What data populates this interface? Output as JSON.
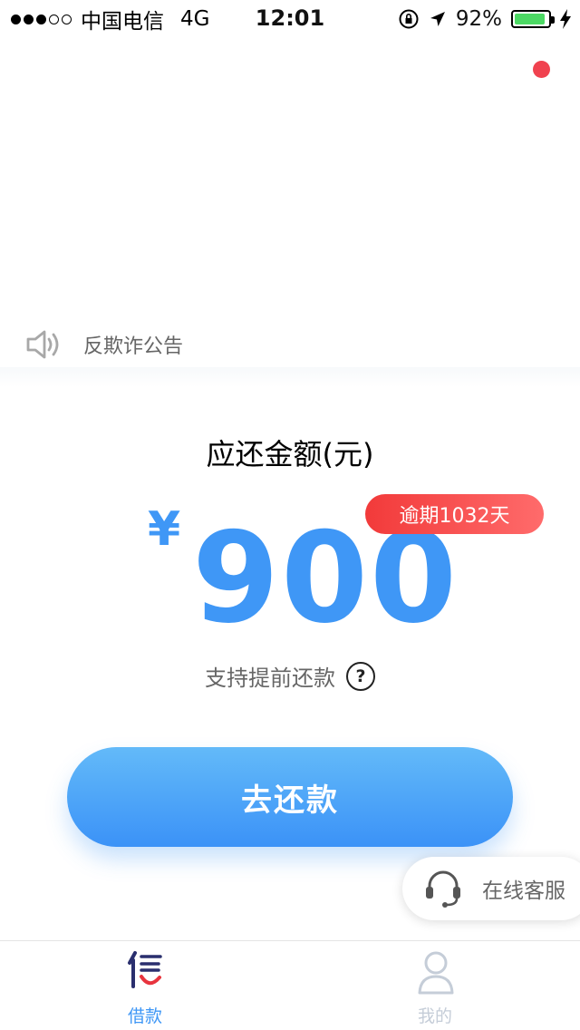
{
  "status_bar": {
    "carrier": "中国电信",
    "network": "4G",
    "time": "12:01",
    "battery": "92%",
    "battery_level": 0.92
  },
  "notice": {
    "icon": "speaker-icon",
    "label": "反欺诈公告"
  },
  "loan": {
    "amount_title": "应还金额(元)",
    "currency_symbol": "¥",
    "amount": "900",
    "overdue_badge": "逾期1032天",
    "prepay_text": "支持提前还款",
    "help_icon": "question-circle-icon"
  },
  "actions": {
    "repay_button": "去还款"
  },
  "customer_service": {
    "icon": "headset-icon",
    "label": "在线客服"
  },
  "tab_bar": {
    "items": [
      {
        "label": "借款",
        "icon": "loan-logo-icon",
        "active": true
      },
      {
        "label": "我的",
        "icon": "user-icon",
        "active": false
      }
    ]
  },
  "colors": {
    "accent": "#3f97f6",
    "overdue": "#f23a3a",
    "notification_dot": "#f0424f",
    "inactive": "#c5cdd8"
  }
}
